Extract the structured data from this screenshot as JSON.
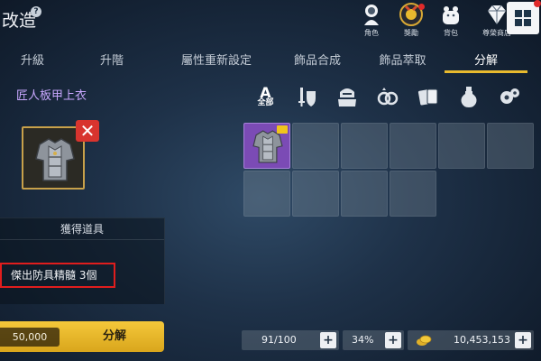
{
  "header": {
    "title": "改造",
    "help_glyph": "?",
    "icons": [
      {
        "name": "character",
        "label": "角色"
      },
      {
        "name": "rewards",
        "label": "獎勵"
      },
      {
        "name": "bag",
        "label": "背包"
      },
      {
        "name": "premium-shop",
        "label": "尊榮商店"
      }
    ]
  },
  "tabs": [
    {
      "label": "升級"
    },
    {
      "label": "升階"
    },
    {
      "label": "屬性重新設定"
    },
    {
      "label": "飾品合成"
    },
    {
      "label": "飾品萃取"
    },
    {
      "label": "分解",
      "active": true
    }
  ],
  "selected_item": {
    "name": "匠人板甲上衣",
    "remove_glyph": "✕"
  },
  "rewards": {
    "heading": "獲得道具",
    "line": "傑出防具精髓 3個"
  },
  "action": {
    "cost": "50,000",
    "label": "分解"
  },
  "filters": {
    "all_top": "A",
    "all_bottom": "全部"
  },
  "inventory": {
    "filled_slots": 1
  },
  "stats": {
    "capacity": "91/100",
    "percent": "34%",
    "gold": "10,453,153",
    "plus_glyph": "+"
  },
  "colors": {
    "accent": "#e8ba2e",
    "item_name": "#c9a8ff",
    "highlight": "#e01d1d",
    "epic_slot": "#7b4bb5"
  }
}
